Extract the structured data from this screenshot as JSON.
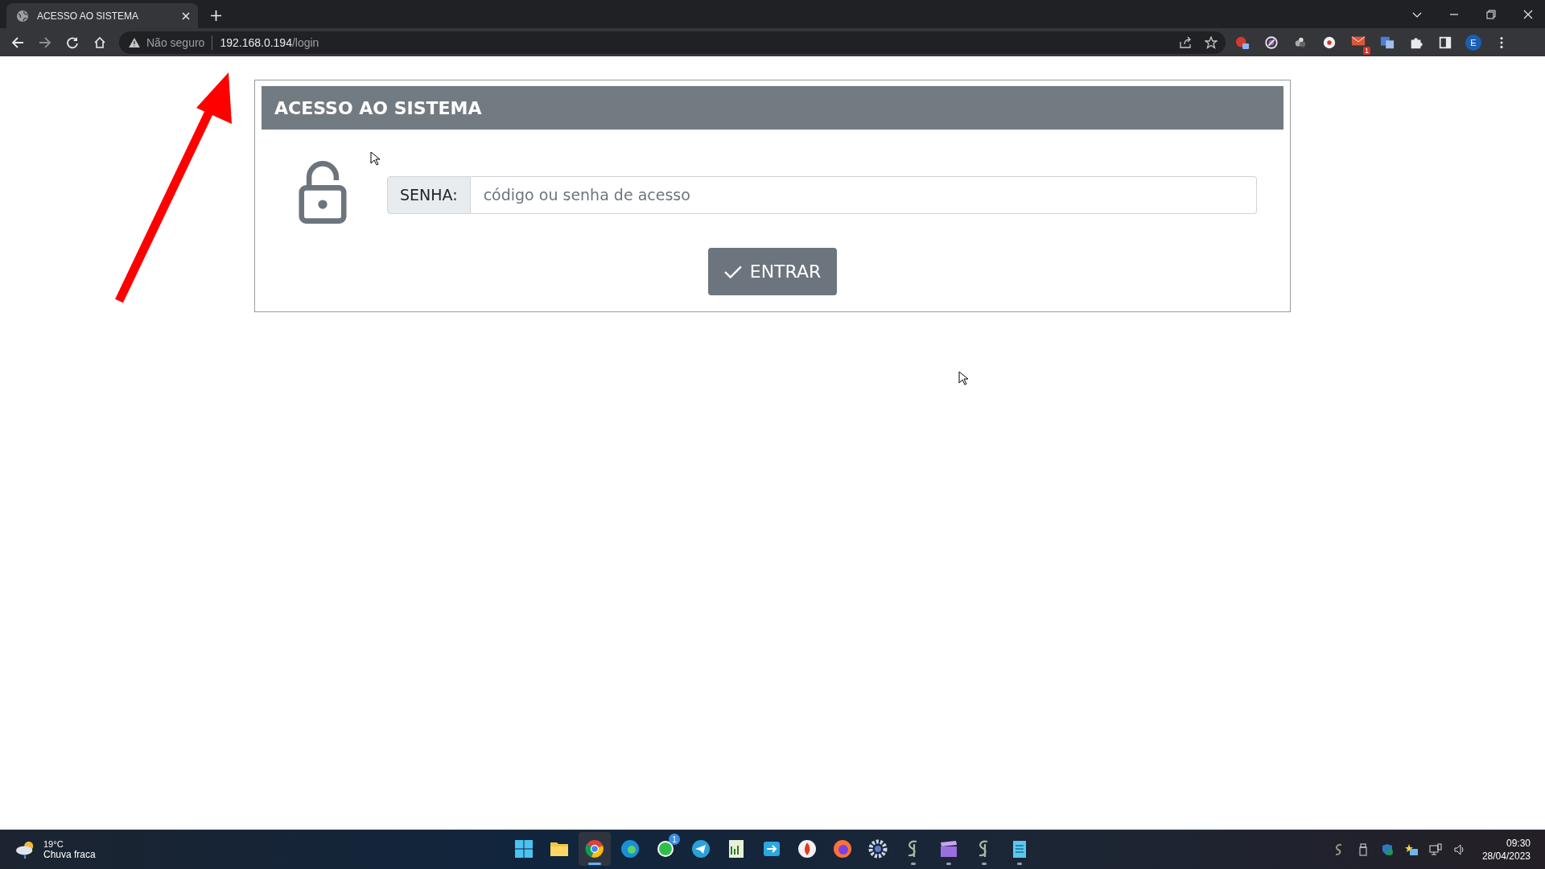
{
  "browser": {
    "tab": {
      "title": "ACESSO AO SISTEMA"
    },
    "security_label": "Não seguro",
    "url": {
      "host": "192.168.0.194",
      "path": "/login"
    },
    "mail_badge": "1",
    "profile_initial": "E"
  },
  "login": {
    "title": "ACESSO AO SISTEMA",
    "field_label": "SENHA:",
    "placeholder": "código ou senha de acesso",
    "submit": "ENTRAR"
  },
  "taskbar": {
    "weather": {
      "temperature": "19°C",
      "condition": "Chuva fraca"
    },
    "apps": [
      {
        "kind": "start",
        "selected": false,
        "running": false
      },
      {
        "kind": "folder",
        "selected": false,
        "running": false
      },
      {
        "kind": "chrome",
        "selected": true,
        "running": true
      },
      {
        "kind": "edge",
        "selected": false,
        "running": false
      },
      {
        "kind": "whatsapp",
        "selected": false,
        "running": false,
        "badge": "1"
      },
      {
        "kind": "telegram",
        "selected": false,
        "running": false
      },
      {
        "kind": "sheet",
        "selected": false,
        "running": false
      },
      {
        "kind": "transfer",
        "selected": false,
        "running": false
      },
      {
        "kind": "flame",
        "selected": false,
        "running": false
      },
      {
        "kind": "firefox",
        "selected": false,
        "running": false
      },
      {
        "kind": "gear",
        "selected": false,
        "running": false
      },
      {
        "kind": "script",
        "selected": false,
        "running": true
      },
      {
        "kind": "clapper",
        "selected": false,
        "running": true
      },
      {
        "kind": "script",
        "selected": false,
        "running": true
      },
      {
        "kind": "notepad",
        "selected": false,
        "running": true
      }
    ],
    "clock": {
      "time": "09:30",
      "date": "28/04/2023"
    }
  }
}
